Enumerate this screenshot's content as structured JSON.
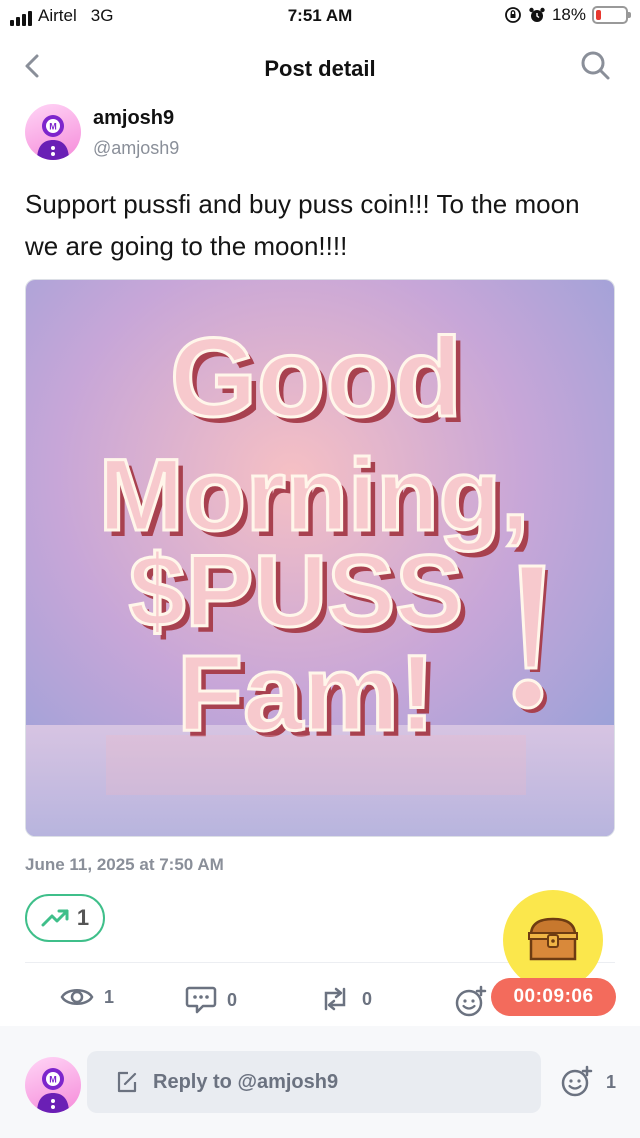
{
  "status_bar": {
    "carrier": "Airtel",
    "network": "3G",
    "time": "7:51 AM",
    "battery_percent": "18%",
    "battery_level": 0.18,
    "battery_color": "#e8382f"
  },
  "header": {
    "title": "Post detail",
    "back_icon": "chevron-left-icon",
    "search_icon": "search-icon"
  },
  "author": {
    "name": "amjosh9",
    "handle": "@amjosh9"
  },
  "post": {
    "text": "Support pussfi and buy puss coin!!! To the moon we are going to the moon!!!!",
    "image": {
      "lines": [
        "Good",
        "Morning,",
        "$PUSS",
        "Fam!"
      ]
    },
    "timestamp": "June 11, 2025 at 7:50 AM",
    "trend_count": "1",
    "accent_color": "#3fbf8a"
  },
  "stats": {
    "views": "1",
    "comments": "0",
    "reposts": "0"
  },
  "floating": {
    "treasure_icon": "treasure-chest-icon",
    "timer": "00:09:06",
    "timer_color": "#f36b5c"
  },
  "reply_bar": {
    "placeholder": "Reply to @amjosh9",
    "reaction_count": "1"
  }
}
